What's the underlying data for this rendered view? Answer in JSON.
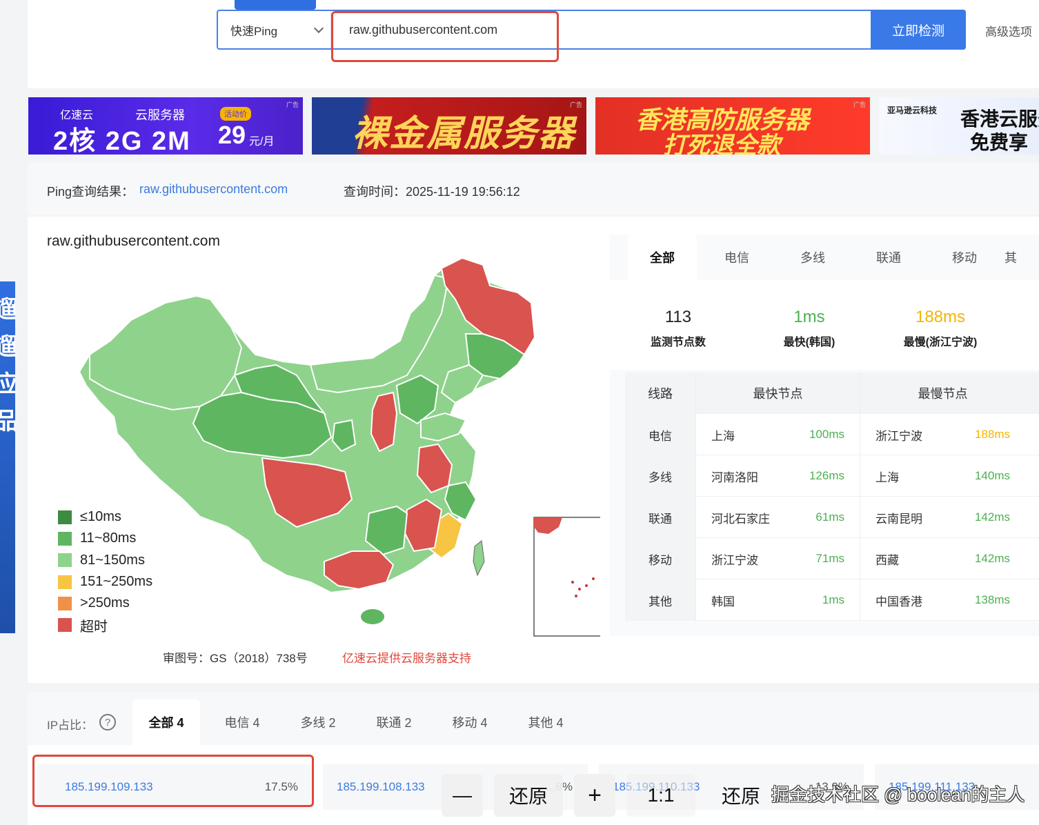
{
  "search": {
    "mode": "快速Ping",
    "url_value": "raw.githubusercontent.com",
    "check_button": "立即检测",
    "advanced": "高级选项"
  },
  "banners": {
    "b1": {
      "brand": "亿速云",
      "service": "云服务器",
      "tag": "活动价",
      "spec": "2核 2G 2M",
      "price": "29",
      "unit": "元/月",
      "ad": "广告"
    },
    "b2": {
      "text": "裸金属服务器",
      "ad": "广告"
    },
    "b3": {
      "line1": "香港高防服务器",
      "line2": "打死退全款",
      "ad": "广告"
    },
    "b4": {
      "company": "亚马逊云科技",
      "line1": "香港云服务器",
      "line2": "免费享"
    }
  },
  "result": {
    "label": "Ping查询结果：",
    "host": "raw.githubusercontent.com",
    "time": "查询时间：2025-11-19 19:56:12"
  },
  "map": {
    "title": "raw.githubusercontent.com",
    "legend": [
      {
        "label": "≤10ms",
        "color": "#3d8b40"
      },
      {
        "label": "11~80ms",
        "color": "#5fb661"
      },
      {
        "label": "81~150ms",
        "color": "#8fd28c"
      },
      {
        "label": "151~250ms",
        "color": "#f7c444"
      },
      {
        "label": ">250ms",
        "color": "#f0914a"
      },
      {
        "label": "超时",
        "color": "#d9534f"
      }
    ],
    "gs_note": "审图号：GS（2018）738号",
    "support_note": "亿速云提供云服务器支持"
  },
  "panel": {
    "tabs": [
      "全部",
      "电信",
      "多线",
      "联通",
      "移动",
      "其"
    ],
    "stats": [
      {
        "value": "113",
        "label": "监测节点数",
        "color": "#222"
      },
      {
        "value": "1ms",
        "label": "最快(韩国)",
        "color": "#4caf50"
      },
      {
        "value": "188ms",
        "label": "最慢(浙江宁波)",
        "color": "#f5b400"
      }
    ],
    "table_headers": [
      "线路",
      "最快节点",
      "最慢节点"
    ],
    "rows": [
      {
        "line": "电信",
        "fast": "上海",
        "fast_ms": "100ms",
        "slow": "浙江宁波",
        "slow_ms": "188ms"
      },
      {
        "line": "多线",
        "fast": "河南洛阳",
        "fast_ms": "126ms",
        "slow": "上海",
        "slow_ms": "140ms"
      },
      {
        "line": "联通",
        "fast": "河北石家庄",
        "fast_ms": "61ms",
        "slow": "云南昆明",
        "slow_ms": "142ms"
      },
      {
        "line": "移动",
        "fast": "浙江宁波",
        "fast_ms": "71ms",
        "slow": "西藏",
        "slow_ms": "142ms"
      },
      {
        "line": "其他",
        "fast": "韩国",
        "fast_ms": "1ms",
        "slow": "中国香港",
        "slow_ms": "138ms"
      }
    ]
  },
  "ip": {
    "label": "IP占比：",
    "help": "?",
    "tabs": [
      "全部 4",
      "电信 4",
      "多线 2",
      "联通 2",
      "移动 4",
      "其他 4"
    ],
    "boxes": [
      {
        "ip": "185.199.109.133",
        "pct": "17.5%"
      },
      {
        "ip": "185.199.108.133",
        "pct": "...8%"
      },
      {
        "ip": "185.199.110.133",
        "pct": "13.9%"
      },
      {
        "ip": "185.199.111.133",
        "pct": ""
      }
    ]
  },
  "viewer": {
    "minus": "—",
    "restore1": "还原",
    "plus": "+",
    "ratio": "1:1",
    "restore2": "还原",
    "watermark": "掘金技术社区 @ boolean的主人"
  },
  "side_ad": {
    "chars": "遛遛应品"
  }
}
